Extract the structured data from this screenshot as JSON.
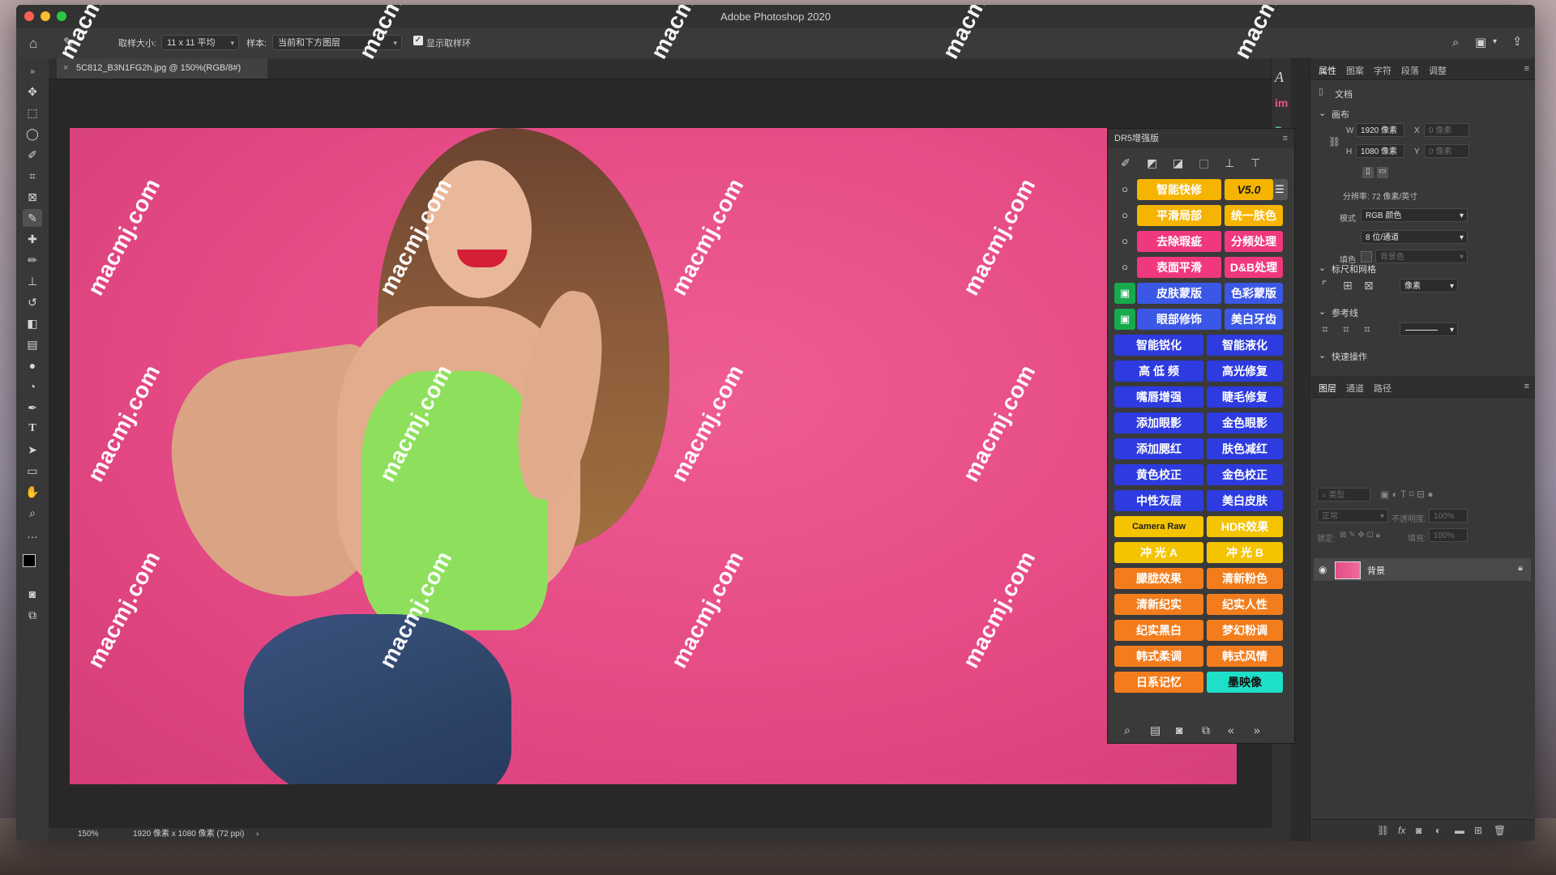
{
  "window": {
    "title": "Adobe Photoshop 2020"
  },
  "options": {
    "sample_size_label": "取样大小:",
    "sample_size_value": "11 x 11 平均",
    "sample_label": "样本:",
    "sample_value": "当前和下方图层",
    "show_ring_label": "显示取样环",
    "show_ring_checked": true
  },
  "document_tab": {
    "title": "5C812_B3N1FG2h.jpg @ 150%(RGB/8#)"
  },
  "status": {
    "zoom": "150%",
    "info": "1920 像素 x 1080 像素 (72 ppi)",
    "arrow": "›"
  },
  "watermark": "macmj.com",
  "properties": {
    "tabs": [
      "属性",
      "图案",
      "字符",
      "段落",
      "调整"
    ],
    "doc_label": "文档",
    "canvas_section": "画布",
    "w_label": "W",
    "w_value": "1920 像素",
    "h_label": "H",
    "h_value": "1080 像素",
    "x_label": "X",
    "x_placeholder": "0 像素",
    "y_label": "Y",
    "y_placeholder": "0 像素",
    "resolution": "分辨率: 72 像素/英寸",
    "mode_label": "模式",
    "mode_value": "RGB 颜色",
    "bit_value": "8 位/通道",
    "fill_label": "填色",
    "fill_value": "背景色",
    "rulers_section": "标尺和网格",
    "units_value": "像素",
    "guides_section": "参考线",
    "quick_section": "快速操作"
  },
  "layers": {
    "tabs": [
      "图层",
      "通道",
      "路径"
    ],
    "kind_placeholder": "类型",
    "blend_value": "正常",
    "opacity_label": "不透明度:",
    "opacity_value": "100%",
    "lock_label": "锁定:",
    "fill_label": "填充:",
    "fill_value": "100%",
    "layer_name": "背景"
  },
  "dr5": {
    "title": "DR5增强版",
    "version": "V5.0",
    "rows": [
      {
        "left": "智能快修",
        "right": "",
        "left_color": "#f5b400",
        "right_color": "#f5b400",
        "lead_color": "#3a3a3a"
      },
      {
        "left": "平滑局部",
        "right": "统一肤色",
        "left_color": "#f5b400",
        "right_color": "#f5b400",
        "lead_color": "#3a3a3a"
      },
      {
        "left": "去除瑕疵",
        "right": "分频处理",
        "left_color": "#f0387e",
        "right_color": "#f0387e",
        "lead_color": "#3a3a3a"
      },
      {
        "left": "表面平滑",
        "right": "D&B处理",
        "left_color": "#f0387e",
        "right_color": "#f0387e",
        "lead_color": "#3a3a3a"
      },
      {
        "left": "皮肤蒙版",
        "right": "色彩蒙版",
        "left_color": "#3a57e6",
        "right_color": "#3a57e6",
        "lead_color": "#17a94b"
      },
      {
        "left": "眼部修饰",
        "right": "美白牙齿",
        "left_color": "#3a57e6",
        "right_color": "#3a57e6",
        "lead_color": "#17a94b"
      },
      {
        "left": "智能锐化",
        "right": "智能液化",
        "left_color": "#2d3be0",
        "right_color": "#2d3be0",
        "lead_color": ""
      },
      {
        "left": "高 低 频",
        "right": "高光修复",
        "left_color": "#2d3be0",
        "right_color": "#2d3be0",
        "lead_color": ""
      },
      {
        "left": "嘴唇增强",
        "right": "睫毛修复",
        "left_color": "#2d3be0",
        "right_color": "#2d3be0",
        "lead_color": ""
      },
      {
        "left": "添加眼影",
        "right": "金色眼影",
        "left_color": "#2d3be0",
        "right_color": "#2d3be0",
        "lead_color": ""
      },
      {
        "left": "添加腮红",
        "right": "肤色减红",
        "left_color": "#2d3be0",
        "right_color": "#2d3be0",
        "lead_color": ""
      },
      {
        "left": "黄色校正",
        "right": "金色校正",
        "left_color": "#2d3be0",
        "right_color": "#2d3be0",
        "lead_color": ""
      },
      {
        "left": "中性灰层",
        "right": "美白皮肤",
        "left_color": "#2d3be0",
        "right_color": "#2d3be0",
        "lead_color": ""
      },
      {
        "left": "Camera Raw",
        "right": "HDR效果",
        "left_color": "#f5c400",
        "right_color": "#f5c400",
        "lead_color": ""
      },
      {
        "left": "冲 光 A",
        "right": "冲 光 B",
        "left_color": "#f5c400",
        "right_color": "#f5c400",
        "lead_color": ""
      },
      {
        "left": "朦胧效果",
        "right": "清新粉色",
        "left_color": "#f37d1c",
        "right_color": "#f37d1c",
        "lead_color": ""
      },
      {
        "left": "清新纪实",
        "right": "纪实人性",
        "left_color": "#f37d1c",
        "right_color": "#f37d1c",
        "lead_color": ""
      },
      {
        "left": "纪实黑白",
        "right": "梦幻粉调",
        "left_color": "#f37d1c",
        "right_color": "#f37d1c",
        "lead_color": ""
      },
      {
        "left": "韩式柔调",
        "right": "韩式风情",
        "left_color": "#f37d1c",
        "right_color": "#f37d1c",
        "lead_color": ""
      },
      {
        "left": "日系记忆",
        "right": "墨映像",
        "left_color": "#f37d1c",
        "right_color": "#1ee0c8",
        "lead_color": ""
      }
    ]
  }
}
